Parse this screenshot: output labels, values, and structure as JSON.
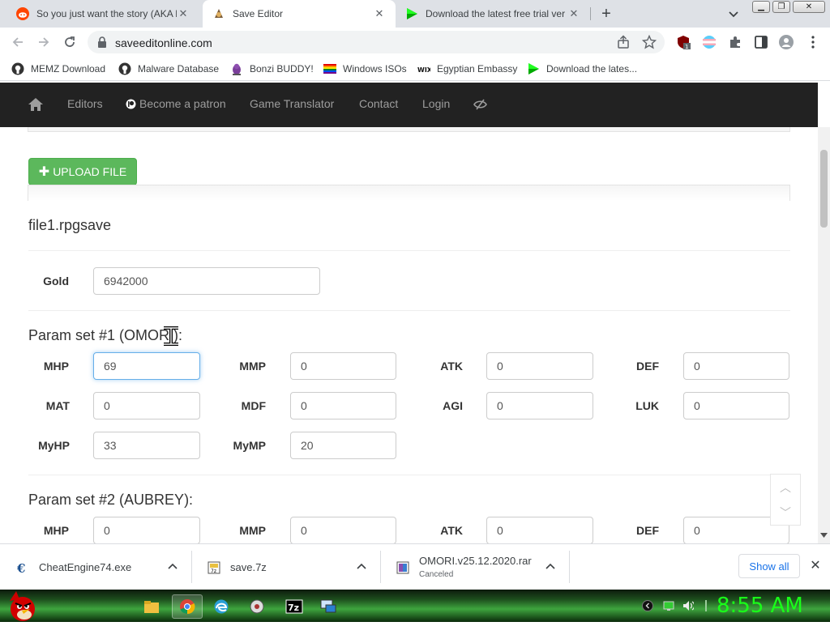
{
  "browser": {
    "tabs": [
      {
        "title": "So you just want the story (AKA l",
        "favicon": "reddit-icon",
        "active": false
      },
      {
        "title": "Save Editor",
        "favicon": "save-editor-icon",
        "active": true
      },
      {
        "title": "Download the latest free trial ver",
        "favicon": "play-triangle-icon",
        "active": false
      }
    ],
    "url": "saveeditonline.com",
    "extension_badge": "1",
    "bookmarks": [
      {
        "label": "MEMZ Download",
        "icon": "github-icon"
      },
      {
        "label": "Malware Database",
        "icon": "github-icon"
      },
      {
        "label": "Bonzi BUDDY!",
        "icon": "bonzi-icon"
      },
      {
        "label": "Windows ISOs",
        "icon": "rainbow-flag-icon"
      },
      {
        "label": "Egyptian Embassy",
        "icon": "wix-icon"
      },
      {
        "label": "Download the lates...",
        "icon": "play-triangle-icon"
      }
    ]
  },
  "site_nav": {
    "items": [
      "Editors",
      "Become a patron",
      "Game Translator",
      "Contact",
      "Login"
    ]
  },
  "editor": {
    "upload_label": "UPLOAD FILE",
    "filename": "file1.rpgsave",
    "gold_label": "Gold",
    "gold_value": "6942000",
    "param_set_1": {
      "title": "Param set #1 (OMORI):",
      "fields": [
        {
          "label": "MHP",
          "value": "69"
        },
        {
          "label": "MMP",
          "value": "0"
        },
        {
          "label": "ATK",
          "value": "0"
        },
        {
          "label": "DEF",
          "value": "0"
        },
        {
          "label": "MAT",
          "value": "0"
        },
        {
          "label": "MDF",
          "value": "0"
        },
        {
          "label": "AGI",
          "value": "0"
        },
        {
          "label": "LUK",
          "value": "0"
        },
        {
          "label": "MyHP",
          "value": "33"
        },
        {
          "label": "MyMP",
          "value": "20"
        }
      ]
    },
    "param_set_2": {
      "title": "Param set #2 (AUBREY):",
      "fields": [
        {
          "label": "MHP",
          "value": "0"
        },
        {
          "label": "MMP",
          "value": "0"
        },
        {
          "label": "ATK",
          "value": "0"
        },
        {
          "label": "DEF",
          "value": "0"
        }
      ]
    }
  },
  "downloads": {
    "items": [
      {
        "name": "CheatEngine74.exe",
        "status": "",
        "icon": "cheat-engine-icon"
      },
      {
        "name": "save.7z",
        "status": "",
        "icon": "archive-icon"
      },
      {
        "name": "OMORI.v25.12.2020.rar",
        "status": "Canceled",
        "icon": "rar-archive-icon"
      }
    ],
    "show_all_label": "Show all"
  },
  "taskbar": {
    "clock": "8:55 AM"
  },
  "colors": {
    "upload_button": "#5cb85c",
    "site_nav_bg": "#222222",
    "clock_green": "#19ff19",
    "focus_border": "#66afe9"
  }
}
